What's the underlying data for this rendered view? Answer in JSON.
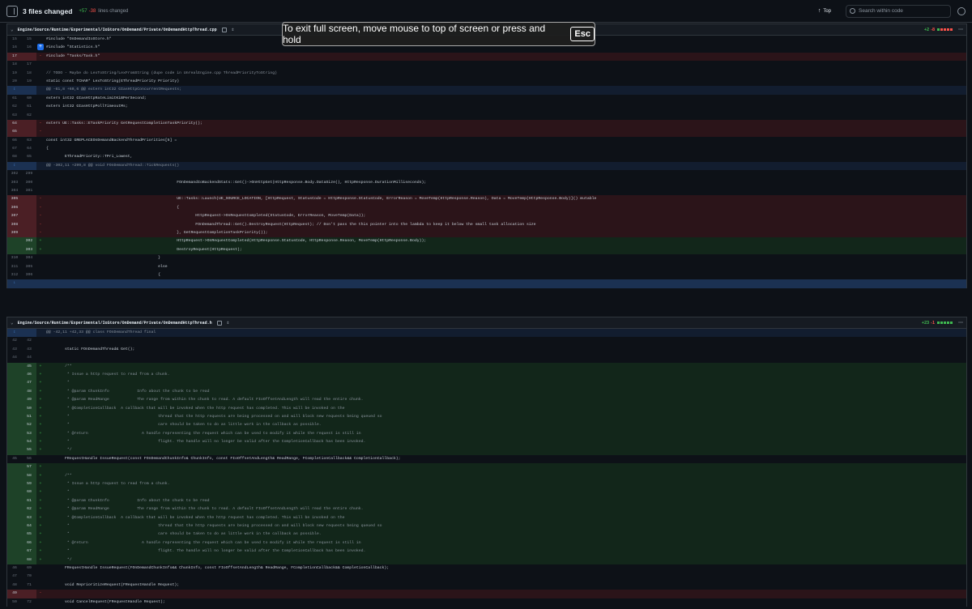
{
  "toolbar": {
    "files_changed": "3 files changed",
    "additions": "+57",
    "deletions": "-38",
    "lines_changed": "lines changed",
    "top_label": "Top",
    "search_placeholder": "Search within code"
  },
  "fullscreen_banner": {
    "text": "To exit full screen, move mouse to top of screen or press and hold",
    "key": "Esc"
  },
  "files": [
    {
      "path": "Engine/Source/Runtime/Experimental/IoStore/OnDemand/Private/OnDemandHttpThread.cpp",
      "additions": "+2",
      "deletions": "-8"
    },
    {
      "path": "Engine/Source/Runtime/Experimental/IoStore/OnDemand/Private/OnDemandHttpThread.h",
      "additions": "+23",
      "deletions": "-1"
    }
  ],
  "diff1": [
    {
      "t": "ctx",
      "o": "15",
      "n": "15",
      "c": "#include \"OnDemandIoStore.h\""
    },
    {
      "t": "ctx",
      "o": "16",
      "n": "16",
      "c": "#include \"Statistics.h\"",
      "btn": true
    },
    {
      "t": "del",
      "o": "17",
      "n": "",
      "c": "#include \"Tasks/Task.h\""
    },
    {
      "t": "ctx",
      "o": "18",
      "n": "17",
      "c": ""
    },
    {
      "t": "ctx",
      "o": "19",
      "n": "18",
      "c": "// TODO - Maybe do LexToString/LexFromString (dupe code in UnrealEngine.cpp ThreadPriorityToString)"
    },
    {
      "t": "ctx",
      "o": "20",
      "n": "19",
      "c": "static const TCHAR* LexToString(EThreadPriority Priority)"
    },
    {
      "t": "hunk",
      "c": "@@ -61,8 +60,6 @@ extern int32 GIasHttpConcurrentRequests;"
    },
    {
      "t": "ctx",
      "o": "61",
      "n": "60",
      "c": "extern int32 GIasHttpRateLimitKiBPerSecond;"
    },
    {
      "t": "ctx",
      "o": "62",
      "n": "61",
      "c": "extern int32 GIasHttpPollTimeoutMs;"
    },
    {
      "t": "ctx",
      "o": "63",
      "n": "62",
      "c": ""
    },
    {
      "t": "del",
      "o": "64",
      "n": "",
      "c": "extern UE::Tasks::ETaskPriority GetRequestCompletionTaskPriority();"
    },
    {
      "t": "del",
      "o": "65",
      "n": "",
      "c": ""
    },
    {
      "t": "ctx",
      "o": "66",
      "n": "63",
      "c": "const int32 GREPLACEOnDemandBackendThreadPriorities[5] ="
    },
    {
      "t": "ctx",
      "o": "67",
      "n": "64",
      "c": "{"
    },
    {
      "t": "ctx",
      "o": "68",
      "n": "65",
      "c": "        EThreadPriority::TPri_Lowest,"
    },
    {
      "t": "hunk",
      "c": "@@ -302,11 +299,8 @@ void FOnDemandThread::TickRequests()"
    },
    {
      "t": "ctx",
      "o": "302",
      "n": "299",
      "c": ""
    },
    {
      "t": "ctx",
      "o": "303",
      "n": "300",
      "c": "                                                        FOnDemandIoBackendStats::Get()->OnHttpGet(HttpResponse.Body.DataSize(), HttpResponse.DurationMilliseconds);"
    },
    {
      "t": "ctx",
      "o": "304",
      "n": "301",
      "c": ""
    },
    {
      "t": "del",
      "o": "305",
      "n": "",
      "c": "                                                        UE::Tasks::Launch(UE_SOURCE_LOCATION, [HttpRequest, StatusCode = HttpResponse.StatusCode, ErrorReason = MoveTemp(HttpResponse.Reason), Data = MoveTemp(HttpResponse.Body)]() mutable"
    },
    {
      "t": "del",
      "o": "306",
      "n": "",
      "c": "                                                        {"
    },
    {
      "t": "del",
      "o": "307",
      "n": "",
      "c": "                                                                HttpRequest->OnRequestCompleted(StatusCode, ErrorReason, MoveTemp(Data));"
    },
    {
      "t": "del",
      "o": "308",
      "n": "",
      "c": "                                                                FOnDemandThread::Get().DestroyRequest(HttpRequest); // Don't pass the this pointer into the lambda to keep it below the small task allocation size"
    },
    {
      "t": "del",
      "o": "309",
      "n": "",
      "c": "                                                        }, GetRequestCompletionTaskPriority());"
    },
    {
      "t": "add",
      "o": "",
      "n": "302",
      "c": "                                                        HttpRequest->OnRequestCompleted(HttpResponse.StatusCode, HttpResponse.Reason, MoveTemp(HttpResponse.Body));"
    },
    {
      "t": "add",
      "o": "",
      "n": "303",
      "c": "                                                        DestroyRequest(HttpRequest);"
    },
    {
      "t": "ctx",
      "o": "310",
      "n": "304",
      "c": "                                                }"
    },
    {
      "t": "ctx",
      "o": "311",
      "n": "305",
      "c": "                                                else"
    },
    {
      "t": "ctx",
      "o": "312",
      "n": "306",
      "c": "                                                {"
    }
  ],
  "diff2": [
    {
      "t": "hunk",
      "c": "@@ -42,11 +42,33 @@ class FOnDemandThread final"
    },
    {
      "t": "ctx",
      "o": "42",
      "n": "42",
      "c": ""
    },
    {
      "t": "ctx",
      "o": "43",
      "n": "43",
      "c": "        static FOnDemandThread& Get();"
    },
    {
      "t": "ctx",
      "o": "44",
      "n": "44",
      "c": ""
    },
    {
      "t": "add",
      "o": "",
      "n": "45",
      "c": "        /**"
    },
    {
      "t": "add",
      "o": "",
      "n": "46",
      "c": "         * Issue a http request to read from a chunk."
    },
    {
      "t": "add",
      "o": "",
      "n": "47",
      "c": "         *"
    },
    {
      "t": "add",
      "o": "",
      "n": "48",
      "c": "         * @param ChunkInfo            Info about the chunk to be read"
    },
    {
      "t": "add",
      "o": "",
      "n": "49",
      "c": "         * @param ReadRange            The range from within the chunk to read. A default FIoOffsetAndLength will read the entire chunk."
    },
    {
      "t": "add",
      "o": "",
      "n": "50",
      "c": "         * @CompletionCallback  A callback that will be invoked when the http request has completed. This will be invoked on the"
    },
    {
      "t": "add",
      "o": "",
      "n": "51",
      "c": "         *                                      thread that the http requests are being processed on and will block new requests being queued so"
    },
    {
      "t": "add",
      "o": "",
      "n": "52",
      "c": "         *                                      care should be taken to do as little work in the callback as possible."
    },
    {
      "t": "add",
      "o": "",
      "n": "53",
      "c": "         * @return                       A handle representing the request which can be used to modify it while the request is still in"
    },
    {
      "t": "add",
      "o": "",
      "n": "54",
      "c": "         *                                      flight. The handle will no longer be valid after the CompletionCallback has been invoked."
    },
    {
      "t": "add",
      "o": "",
      "n": "55",
      "c": "         */"
    },
    {
      "t": "ctx",
      "o": "45",
      "n": "56",
      "c": "        FRequestHandle IssueRequest(const FOnDemandChunkInfo& ChunkInfo, const FIoOffsetAndLength& ReadRange, FCompletionCallback&& CompletionCallback);"
    },
    {
      "t": "add",
      "o": "",
      "n": "57",
      "c": ""
    },
    {
      "t": "add",
      "o": "",
      "n": "58",
      "c": "        /**"
    },
    {
      "t": "add",
      "o": "",
      "n": "59",
      "c": "         * Issue a http request to read from a chunk."
    },
    {
      "t": "add",
      "o": "",
      "n": "60",
      "c": "         *"
    },
    {
      "t": "add",
      "o": "",
      "n": "61",
      "c": "         * @param ChunkInfo            Info about the chunk to be read"
    },
    {
      "t": "add",
      "o": "",
      "n": "62",
      "c": "         * @param ReadRange            The range from within the chunk to read. A default FIoOffsetAndLength will read the entire chunk."
    },
    {
      "t": "add",
      "o": "",
      "n": "63",
      "c": "         * @CompletionCallback  A callback that will be invoked when the http request has completed. This will be invoked on the"
    },
    {
      "t": "add",
      "o": "",
      "n": "64",
      "c": "         *                                      thread that the http requests are being processed on and will block new requests being queued so"
    },
    {
      "t": "add",
      "o": "",
      "n": "65",
      "c": "         *                                      care should be taken to do as little work in the callback as possible."
    },
    {
      "t": "add",
      "o": "",
      "n": "66",
      "c": "         * @return                       A handle representing the request which can be used to modify it while the request is still in"
    },
    {
      "t": "add",
      "o": "",
      "n": "67",
      "c": "         *                                      flight. The handle will no longer be valid after the CompletionCallback has been invoked."
    },
    {
      "t": "add",
      "o": "",
      "n": "68",
      "c": "         */"
    },
    {
      "t": "ctx",
      "o": "46",
      "n": "69",
      "c": "        FRequestHandle IssueRequest(FOnDemandChunkInfo&& ChunkInfo, const FIoOffsetAndLength& ReadRange, FCompletionCallback&& CompletionCallback);"
    },
    {
      "t": "ctx",
      "o": "47",
      "n": "70",
      "c": ""
    },
    {
      "t": "ctx",
      "o": "48",
      "n": "71",
      "c": "        void ReprioritizeRequest(FRequestHandle Request);"
    },
    {
      "t": "del",
      "o": "49",
      "n": "",
      "c": ""
    },
    {
      "t": "ctx",
      "o": "50",
      "n": "72",
      "c": "        void CancelRequest(FRequestHandle Request);"
    }
  ],
  "colors": {
    "add": "#3fb950",
    "del": "#f85149",
    "link": "#58a6ff",
    "bg": "#0d1117"
  }
}
